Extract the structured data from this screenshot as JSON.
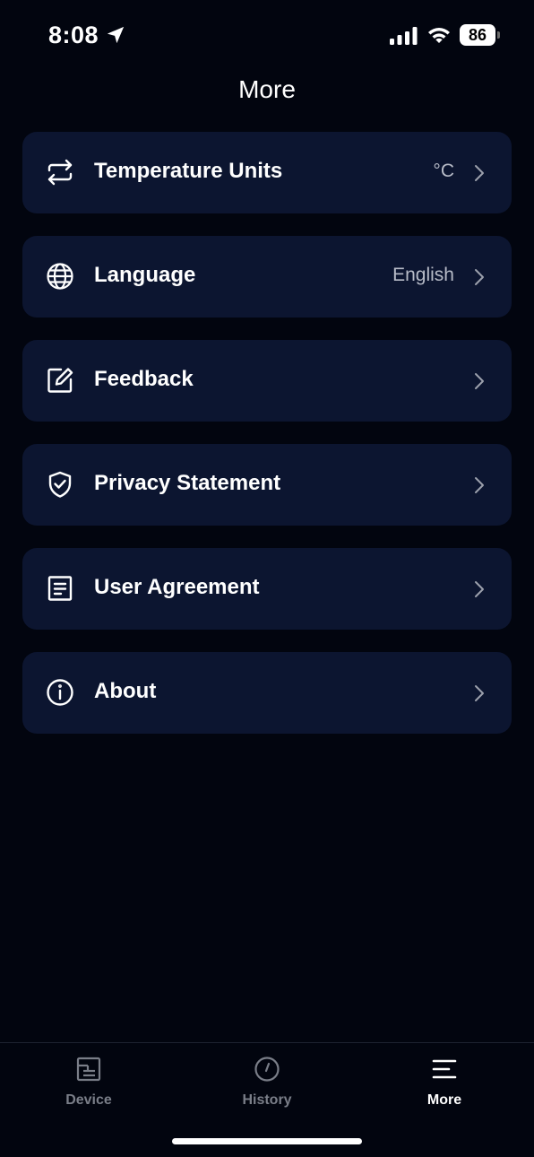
{
  "status_bar": {
    "time": "8:08",
    "battery": "86"
  },
  "header": {
    "title": "More"
  },
  "menu": {
    "items": [
      {
        "label": "Temperature Units",
        "value": "°C",
        "icon": "swap-arrows-icon"
      },
      {
        "label": "Language",
        "value": "English",
        "icon": "globe-icon"
      },
      {
        "label": "Feedback",
        "value": "",
        "icon": "edit-icon"
      },
      {
        "label": "Privacy Statement",
        "value": "",
        "icon": "shield-check-icon"
      },
      {
        "label": "User Agreement",
        "value": "",
        "icon": "document-icon"
      },
      {
        "label": "About",
        "value": "",
        "icon": "info-icon"
      }
    ]
  },
  "tab_bar": {
    "tabs": [
      {
        "label": "Device",
        "icon": "device-icon",
        "active": false
      },
      {
        "label": "History",
        "icon": "clock-icon",
        "active": false
      },
      {
        "label": "More",
        "icon": "menu-icon",
        "active": true
      }
    ]
  },
  "colors": {
    "background": "#02050F",
    "card": "#0C1530",
    "text": "#FFFFFF",
    "secondary_text": "#B7BBC7",
    "inactive_tab": "#7A7E88"
  }
}
